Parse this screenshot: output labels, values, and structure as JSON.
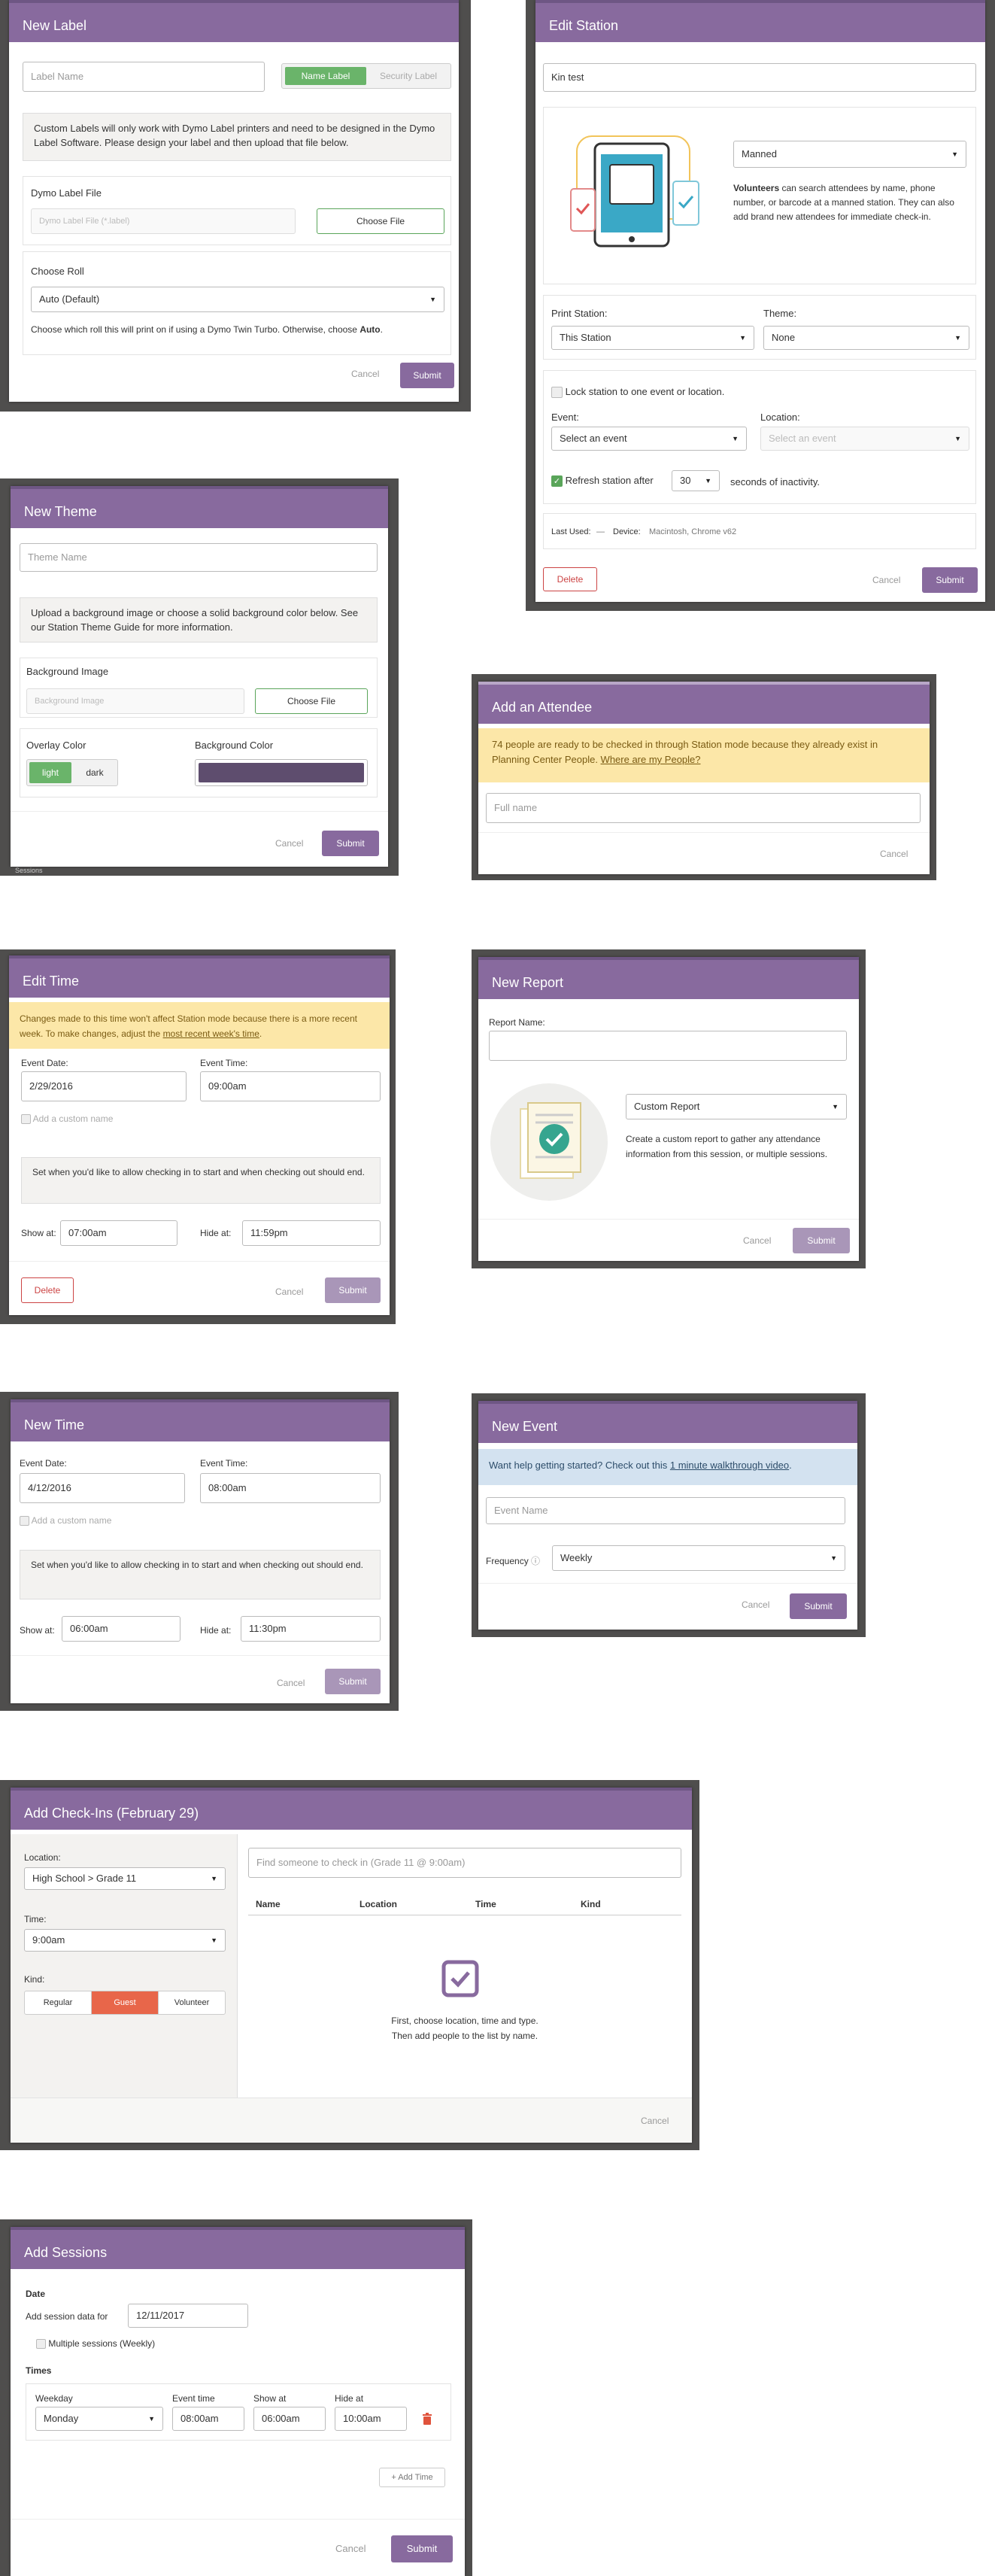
{
  "colors": {
    "purple": "#886a9e",
    "green": "#5aa55a",
    "orange": "#e8664a",
    "backdrop": "#4f4e4d"
  },
  "new_label": {
    "title": "New Label",
    "name_placeholder": "Label Name",
    "toggle_name": "Name Label",
    "toggle_security": "Security Label",
    "info": "Custom Labels will only work with Dymo Label printers and need to be designed in the Dymo Label Software. Please design your label and then upload that file below.",
    "file_heading": "Dymo Label File",
    "file_placeholder": "Dymo Label File (*.label)",
    "choose_file": "Choose File",
    "roll_heading": "Choose Roll",
    "roll_value": "Auto (Default)",
    "roll_hint_pre": "Choose which roll this will print on if using a Dymo Twin Turbo. Otherwise, choose ",
    "roll_hint_bold": "Auto",
    "roll_hint_post": ".",
    "cancel": "Cancel",
    "submit": "Submit"
  },
  "edit_station": {
    "title": "Edit Station",
    "name_value": "Kin test",
    "mode_value": "Manned",
    "mode_desc_bold": "Volunteers",
    "mode_desc": " can search attendees by name, phone number, or barcode at a manned station. They can also add brand new attendees for immediate check-in.",
    "print_label": "Print Station:",
    "print_value": "This Station",
    "theme_label": "Theme:",
    "theme_value": "None",
    "lock_label": "Lock station to one event or location.",
    "event_label": "Event:",
    "event_value": "Select an event",
    "location_label": "Location:",
    "location_value": "Select an event",
    "refresh_label": "Refresh station after",
    "refresh_value": "30",
    "refresh_suffix": "seconds of inactivity.",
    "last_used_label": "Last Used:",
    "last_used_dash": "—",
    "device_label": "Device:",
    "device_value": "Macintosh, Chrome v62",
    "delete": "Delete",
    "cancel": "Cancel",
    "submit": "Submit"
  },
  "new_theme": {
    "title": "New Theme",
    "name_placeholder": "Theme Name",
    "info_pre": "Upload a background image or choose a solid background color below. See our ",
    "info_link": "Station Theme Guide",
    "info_post": " for more information.",
    "bg_image_heading": "Background Image",
    "bg_image_placeholder": "Background Image",
    "choose_file": "Choose File",
    "overlay_heading": "Overlay Color",
    "overlay_light": "light",
    "overlay_dark": "dark",
    "bg_color_heading": "Background Color",
    "bg_color_value": "#5e4d6e",
    "cancel": "Cancel",
    "submit": "Submit",
    "bg_peek_text": "Sessions"
  },
  "add_attendee": {
    "title": "Add an Attendee",
    "banner_pre": "74 people are ready to be checked in through Station mode because they already exist in Planning Center People. ",
    "banner_link": "Where are my People?",
    "name_placeholder": "Full name",
    "cancel": "Cancel"
  },
  "edit_time": {
    "title": "Edit Time",
    "banner_pre": "Changes made to this time won't affect Station mode because there is a more recent week. To make changes, adjust the ",
    "banner_link": "most recent week's time",
    "banner_post": ".",
    "date_label": "Event Date:",
    "date_value": "2/29/2016",
    "time_label": "Event Time:",
    "time_value": "09:00am",
    "custom_name": "Add a custom name",
    "info": "Set when you'd like to allow checking in to start and when checking out should end.",
    "show_label": "Show at:",
    "show_value": "07:00am",
    "hide_label": "Hide at:",
    "hide_value": "11:59pm",
    "delete": "Delete",
    "cancel": "Cancel",
    "submit": "Submit"
  },
  "new_report": {
    "title": "New Report",
    "name_label": "Report Name:",
    "type_value": "Custom Report",
    "desc": "Create a custom report to gather any attendance information from this session, or multiple sessions.",
    "cancel": "Cancel",
    "submit": "Submit"
  },
  "new_time": {
    "title": "New Time",
    "date_label": "Event Date:",
    "date_value": "4/12/2016",
    "time_label": "Event Time:",
    "time_value": "08:00am",
    "custom_name": "Add a custom name",
    "info": "Set when you'd like to allow checking in to start and when checking out should end.",
    "show_label": "Show at:",
    "show_value": "06:00am",
    "hide_label": "Hide at:",
    "hide_value": "11:30pm",
    "cancel": "Cancel",
    "submit": "Submit"
  },
  "new_event": {
    "title": "New Event",
    "banner_pre": "Want help getting started? Check out this ",
    "banner_link": "1 minute walkthrough video",
    "banner_post": ".",
    "name_placeholder": "Event Name",
    "freq_label": "Frequency",
    "freq_value": "Weekly",
    "cancel": "Cancel",
    "submit": "Submit"
  },
  "add_checkins": {
    "title": "Add Check-Ins (February 29)",
    "location_label": "Location:",
    "location_value": "High School > Grade 11",
    "time_label": "Time:",
    "time_value": "9:00am",
    "kind_label": "Kind:",
    "kinds": [
      "Regular",
      "Guest",
      "Volunteer"
    ],
    "search_placeholder": "Find someone to check in (Grade 11 @ 9:00am)",
    "columns": [
      "Name",
      "Location",
      "Time",
      "Kind"
    ],
    "empty_line1": "First, choose location, time and type.",
    "empty_line2": "Then add people to the list by name.",
    "cancel": "Cancel"
  },
  "add_sessions": {
    "title": "Add Sessions",
    "date_heading": "Date",
    "date_label": "Add session data for",
    "date_value": "12/11/2017",
    "multiple_label": "Multiple sessions (Weekly)",
    "times_heading": "Times",
    "col_weekday": "Weekday",
    "col_event_time": "Event time",
    "col_show_at": "Show at",
    "col_hide_at": "Hide at",
    "weekday_value": "Monday",
    "event_time_value": "08:00am",
    "show_value": "06:00am",
    "hide_value": "10:00am",
    "add_time": "+ Add Time",
    "cancel": "Cancel",
    "submit": "Submit"
  }
}
